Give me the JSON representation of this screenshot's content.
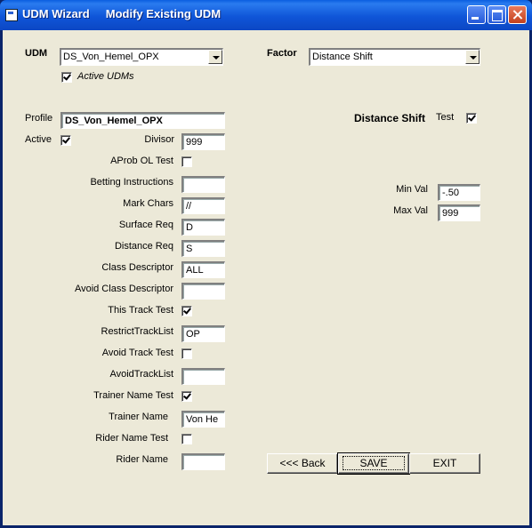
{
  "window": {
    "title": "UDM Wizard     Modify Existing UDM"
  },
  "udm": {
    "label": "UDM",
    "selected": "DS_Von_Hemel_OPX",
    "active_udms_label": "Active UDMs",
    "active_udms_checked": true
  },
  "factor": {
    "label": "Factor",
    "selected": "Distance Shift"
  },
  "profile": {
    "label": "Profile",
    "value": "DS_Von_Hemel_OPX",
    "active_label": "Active",
    "active_checked": true,
    "divisor_label": "Divisor",
    "divisor_value": "999"
  },
  "fields": {
    "aprob_label": "AProb OL Test",
    "aprob_checked": false,
    "betting_label": "Betting Instructions",
    "betting_value": "",
    "markchars_label": "Mark Chars",
    "markchars_value": "//",
    "surface_label": "Surface Req",
    "surface_value": "D",
    "distance_label": "Distance Req",
    "distance_value": "S",
    "classdesc_label": "Class Descriptor",
    "classdesc_value": "ALL",
    "avoidclass_label": "Avoid Class Descriptor",
    "avoidclass_value": "",
    "thistrack_label": "This Track Test",
    "thistrack_checked": true,
    "restrict_label": "RestrictTrackList",
    "restrict_value": "OP",
    "avoidtrack_label": "Avoid Track Test",
    "avoidtrack_checked": false,
    "avoidtracklist_label": "AvoidTrackList",
    "avoidtracklist_value": "",
    "trainertest_label": "Trainer Name Test",
    "trainertest_checked": true,
    "trainername_label": "Trainer Name",
    "trainername_value": "Von He",
    "ridertest_label": "Rider Name Test",
    "ridertest_checked": false,
    "ridername_label": "Rider Name",
    "ridername_value": ""
  },
  "factor_panel": {
    "heading": "Distance Shift",
    "test_label": "Test",
    "test_checked": true,
    "minval_label": "Min Val",
    "minval_value": "-.50",
    "maxval_label": "Max Val",
    "maxval_value": "999"
  },
  "buttons": {
    "back": "<<< Back",
    "save": "SAVE",
    "exit": "EXIT"
  }
}
